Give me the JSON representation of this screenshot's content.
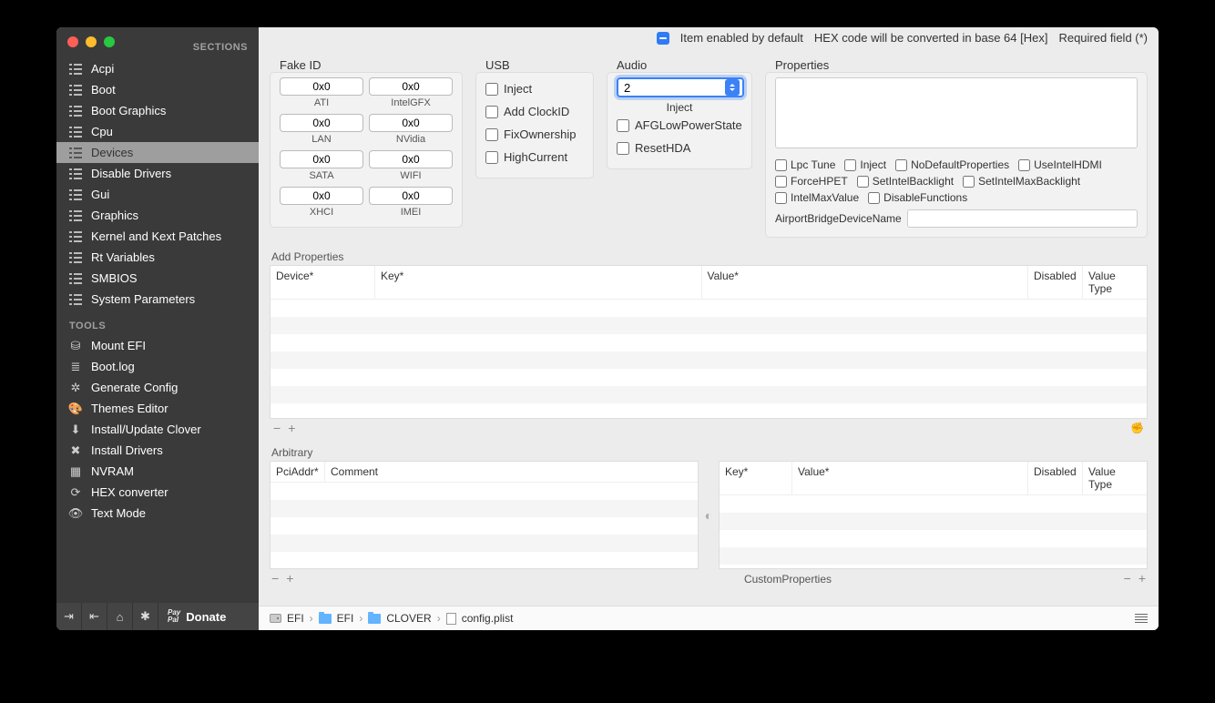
{
  "topbar": {
    "item_enabled": "Item enabled by default",
    "hex_note": "HEX code will be converted in base 64 [Hex]",
    "required": "Required field (*)"
  },
  "sidebar": {
    "sections_header": "SECTIONS",
    "tools_header": "TOOLS",
    "sections": [
      {
        "label": "Acpi"
      },
      {
        "label": "Boot"
      },
      {
        "label": "Boot Graphics"
      },
      {
        "label": "Cpu"
      },
      {
        "label": "Devices"
      },
      {
        "label": "Disable Drivers"
      },
      {
        "label": "Gui"
      },
      {
        "label": "Graphics"
      },
      {
        "label": "Kernel and Kext Patches"
      },
      {
        "label": "Rt Variables"
      },
      {
        "label": "SMBIOS"
      },
      {
        "label": "System Parameters"
      }
    ],
    "tools": [
      {
        "label": "Mount EFI"
      },
      {
        "label": "Boot.log"
      },
      {
        "label": "Generate Config"
      },
      {
        "label": "Themes Editor"
      },
      {
        "label": "Install/Update Clover"
      },
      {
        "label": "Install Drivers"
      },
      {
        "label": "NVRAM"
      },
      {
        "label": "HEX converter"
      },
      {
        "label": "Text Mode"
      }
    ],
    "donate": "Donate",
    "paypal": "Pay\nPal"
  },
  "fakeid": {
    "title": "Fake ID",
    "items": [
      {
        "val": "0x0",
        "lbl": "ATI"
      },
      {
        "val": "0x0",
        "lbl": "IntelGFX"
      },
      {
        "val": "0x0",
        "lbl": "LAN"
      },
      {
        "val": "0x0",
        "lbl": "NVidia"
      },
      {
        "val": "0x0",
        "lbl": "SATA"
      },
      {
        "val": "0x0",
        "lbl": "WIFI"
      },
      {
        "val": "0x0",
        "lbl": "XHCI"
      },
      {
        "val": "0x0",
        "lbl": "IMEI"
      }
    ]
  },
  "usb": {
    "title": "USB",
    "checks": [
      "Inject",
      "Add ClockID",
      "FixOwnership",
      "HighCurrent"
    ]
  },
  "audio": {
    "title": "Audio",
    "value": "2",
    "inject": "Inject",
    "checks": [
      "AFGLowPowerState",
      "ResetHDA"
    ]
  },
  "properties": {
    "title": "Properties",
    "checks": [
      "Lpc Tune",
      "Inject",
      "NoDefaultProperties",
      "UseIntelHDMI",
      "ForceHPET",
      "SetIntelBacklight",
      "SetIntelMaxBacklight",
      "IntelMaxValue",
      "DisableFunctions"
    ],
    "airport_lbl": "AirportBridgeDeviceName",
    "airport_val": ""
  },
  "addprops": {
    "title": "Add Properties",
    "cols": [
      "Device*",
      "Key*",
      "Value*",
      "Disabled",
      "Value Type"
    ]
  },
  "arbitrary": {
    "title": "Arbitrary",
    "left_cols": [
      "PciAddr*",
      "Comment"
    ],
    "right_cols": [
      "Key*",
      "Value*",
      "Disabled",
      "Value Type"
    ],
    "custom": "CustomProperties"
  },
  "breadcrumb": {
    "items": [
      "EFI",
      "EFI",
      "CLOVER",
      "config.plist"
    ]
  }
}
